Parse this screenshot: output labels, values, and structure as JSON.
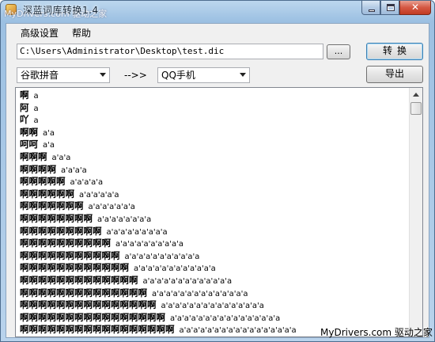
{
  "window": {
    "title": "深蓝词库转换1.4",
    "watermark_top": "MyDrivers.com 驱动之家"
  },
  "menu": {
    "items": [
      {
        "label": "高级设置"
      },
      {
        "label": "帮助"
      }
    ]
  },
  "path": {
    "value": "C:\\Users\\Administrator\\Desktop\\test.dic"
  },
  "browse_label": "...",
  "convert_label": "转换",
  "export_label": "导出",
  "from_format": "谷歌拼音",
  "arrow_text": "-->>",
  "to_format": "QQ手机",
  "output": {
    "lines": [
      {
        "word": "啊",
        "pinyin": "a"
      },
      {
        "word": "阿",
        "pinyin": "a"
      },
      {
        "word": "吖",
        "pinyin": "a"
      },
      {
        "word": "啊啊",
        "pinyin": "a'a"
      },
      {
        "word": "呵呵",
        "pinyin": "a'a"
      },
      {
        "word": "啊啊啊",
        "pinyin": "a'a'a"
      },
      {
        "word": "啊啊啊啊",
        "pinyin": "a'a'a'a"
      },
      {
        "word": "啊啊啊啊啊",
        "pinyin": "a'a'a'a'a"
      },
      {
        "word": "啊啊啊啊啊啊",
        "pinyin": "a'a'a'a'a'a"
      },
      {
        "word": "啊啊啊啊啊啊啊",
        "pinyin": "a'a'a'a'a'a'a"
      },
      {
        "word": "啊啊啊啊啊啊啊啊",
        "pinyin": "a'a'a'a'a'a'a'a"
      },
      {
        "word": "啊啊啊啊啊啊啊啊啊",
        "pinyin": "a'a'a'a'a'a'a'a'a"
      },
      {
        "word": "啊啊啊啊啊啊啊啊啊啊",
        "pinyin": "a'a'a'a'a'a'a'a'a'a"
      },
      {
        "word": "啊啊啊啊啊啊啊啊啊啊啊",
        "pinyin": "a'a'a'a'a'a'a'a'a'a'a"
      },
      {
        "word": "啊啊啊啊啊啊啊啊啊啊啊啊",
        "pinyin": "a'a'a'a'a'a'a'a'a'a'a'a"
      },
      {
        "word": "啊啊啊啊啊啊啊啊啊啊啊啊啊",
        "pinyin": "a'a'a'a'a'a'a'a'a'a'a'a'a"
      },
      {
        "word": "啊啊啊啊啊啊啊啊啊啊啊啊啊啊",
        "pinyin": "a'a'a'a'a'a'a'a'a'a'a'a'a'a"
      },
      {
        "word": "啊啊啊啊啊啊啊啊啊啊啊啊啊啊啊",
        "pinyin": "a'a'a'a'a'a'a'a'a'a'a'a'a'a'a"
      },
      {
        "word": "啊啊啊啊啊啊啊啊啊啊啊啊啊啊啊啊",
        "pinyin": "a'a'a'a'a'a'a'a'a'a'a'a'a'a'a'a"
      },
      {
        "word": "啊啊啊啊啊啊啊啊啊啊啊啊啊啊啊啊啊",
        "pinyin": "a'a'a'a'a'a'a'a'a'a'a'a'a'a'a'a'a"
      }
    ]
  },
  "watermark_bottom": "MyDrivers.com 驱动之家"
}
